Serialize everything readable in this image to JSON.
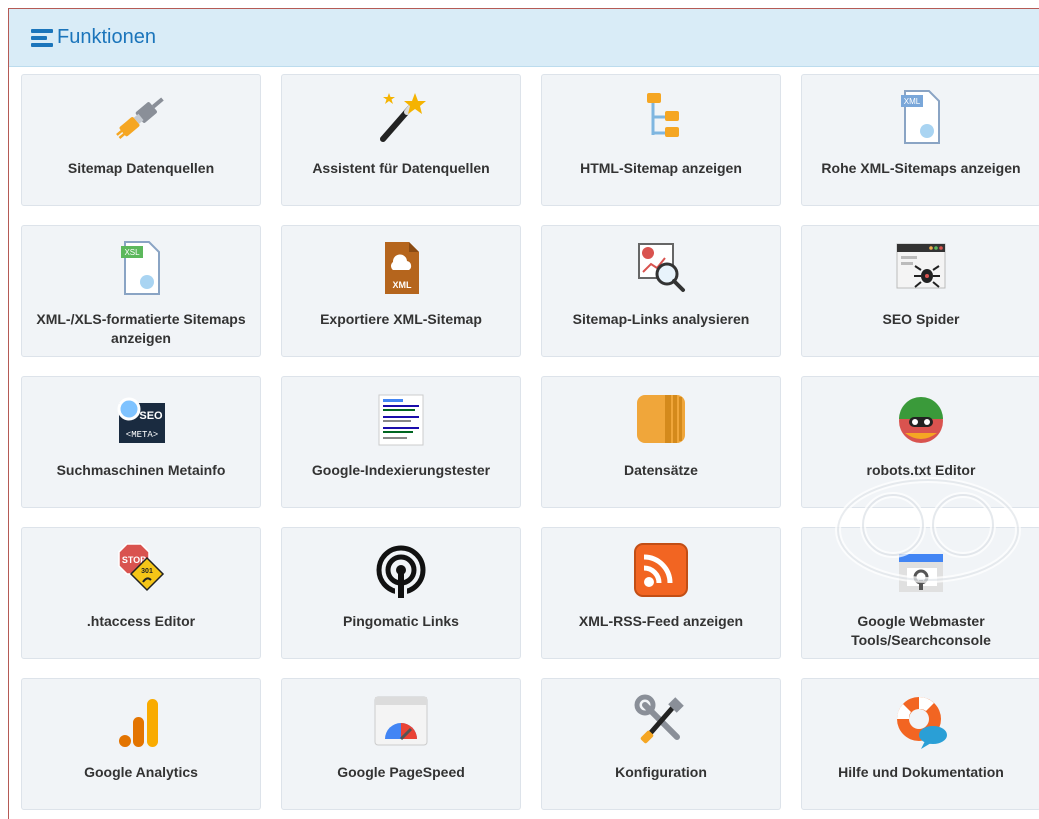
{
  "panel": {
    "title": "Funktionen",
    "header_icon": "server-list-icon",
    "accent": "#1b75bb"
  },
  "tiles": [
    {
      "label": "Sitemap Datenquellen",
      "icon": "plug-icon"
    },
    {
      "label": "Assistent für Datenquellen",
      "icon": "magic-wand-icon"
    },
    {
      "label": "HTML-Sitemap anzeigen",
      "icon": "folder-tree-icon"
    },
    {
      "label": "Rohe XML-Sitemaps anzeigen",
      "icon": "xml-file-icon"
    },
    {
      "label": "XML-/XLS-formatierte Sitemaps anzeigen",
      "icon": "xsl-file-icon"
    },
    {
      "label": "Exportiere XML-Sitemap",
      "icon": "xml-export-icon"
    },
    {
      "label": "Sitemap-Links analysieren",
      "icon": "link-analysis-icon"
    },
    {
      "label": "SEO Spider",
      "icon": "spider-icon"
    },
    {
      "label": "Suchmaschinen Metainfo",
      "icon": "seo-meta-icon"
    },
    {
      "label": "Google-Indexierungstester",
      "icon": "google-doc-icon"
    },
    {
      "label": "Datensätze",
      "icon": "records-icon"
    },
    {
      "label": "robots.txt Editor",
      "icon": "robot-icon"
    },
    {
      "label": ".htaccess Editor",
      "icon": "stop-sign-icon"
    },
    {
      "label": "Pingomatic Links",
      "icon": "broadcast-icon"
    },
    {
      "label": "XML-RSS-Feed anzeigen",
      "icon": "rss-icon"
    },
    {
      "label": "Google Webmaster Tools/Searchconsole",
      "icon": "webmaster-tools-icon"
    },
    {
      "label": "Google Analytics",
      "icon": "analytics-icon"
    },
    {
      "label": "Google PageSpeed",
      "icon": "pagespeed-icon"
    },
    {
      "label": "Konfiguration",
      "icon": "tools-icon"
    },
    {
      "label": "Hilfe und Dokumentation",
      "icon": "lifebuoy-icon"
    }
  ]
}
